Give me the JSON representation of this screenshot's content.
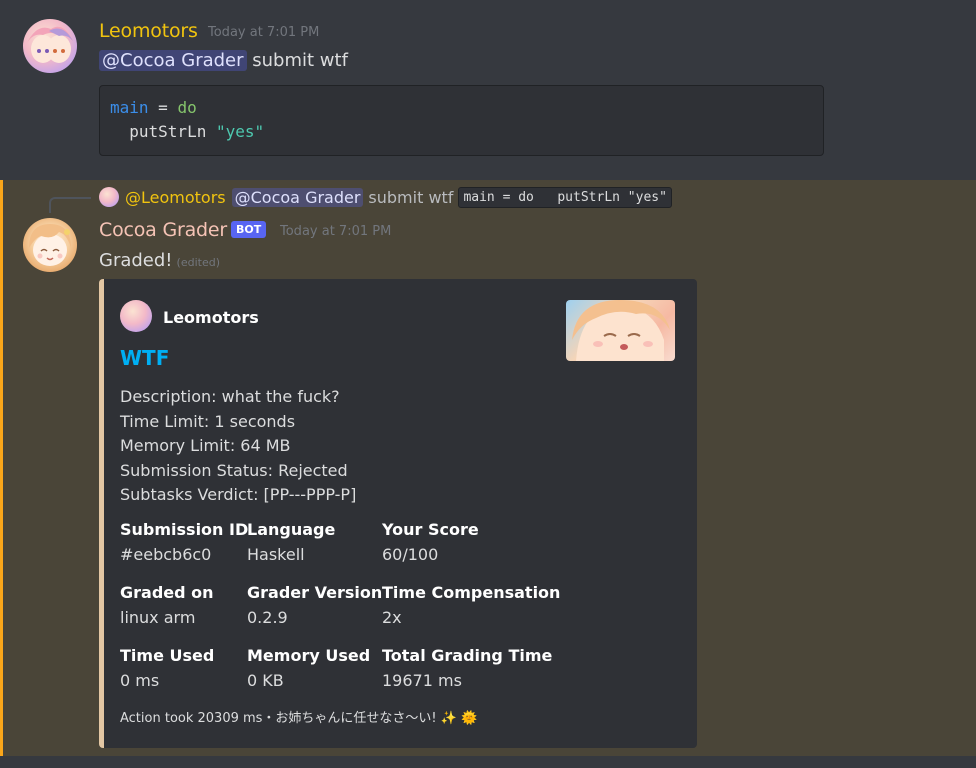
{
  "message1": {
    "username": "Leomotors",
    "timestamp": "Today at 7:01 PM",
    "mention": "@Cocoa Grader",
    "text": "submit wtf",
    "code": {
      "line1_main": "main",
      "line1_eq": " = ",
      "line1_do": "do",
      "line2_indent": "  ",
      "line2_fn": "putStrLn ",
      "line2_str": "\"yes\""
    }
  },
  "reply": {
    "user": "@Leomotors",
    "mention": "@Cocoa Grader",
    "text": "submit wtf",
    "code": "main = do   putStrLn \"yes\""
  },
  "message2": {
    "username": "Cocoa Grader",
    "bot_tag": "BOT",
    "timestamp": "Today at 7:01 PM",
    "text": "Graded!",
    "edited": "(edited)"
  },
  "embed": {
    "author": "Leomotors",
    "title": "WTF",
    "description": [
      "Description: what the fuck?",
      "Time Limit: 1 seconds",
      "Memory Limit: 64 MB",
      "Submission Status: Rejected",
      "Subtasks Verdict: [PP---PPP-P]"
    ],
    "fields": [
      {
        "name": "Submission ID",
        "value": "#eebcb6c0"
      },
      {
        "name": "Language",
        "value": "Haskell"
      },
      {
        "name": "Your Score",
        "value": "60/100"
      },
      {
        "name": "Graded on",
        "value": "linux arm"
      },
      {
        "name": "Grader Version",
        "value": "0.2.9"
      },
      {
        "name": "Time Compensation",
        "value": "2x"
      },
      {
        "name": "Time Used",
        "value": "0 ms"
      },
      {
        "name": "Memory Used",
        "value": "0 KB"
      },
      {
        "name": "Total Grading Time",
        "value": "19671 ms"
      }
    ],
    "footer": "Action took 20309 ms・お姉ちゃんに任せなさ～い! ✨ 🌞"
  },
  "colors": {
    "background": "#36393f",
    "highlight_background": "#4a4538",
    "highlight_bar": "#faa61a",
    "username_leomotors": "#f1c40f",
    "username_cocoa": "#f5c3b5",
    "embed_title": "#00aff4",
    "bot_tag": "#5865f2"
  }
}
